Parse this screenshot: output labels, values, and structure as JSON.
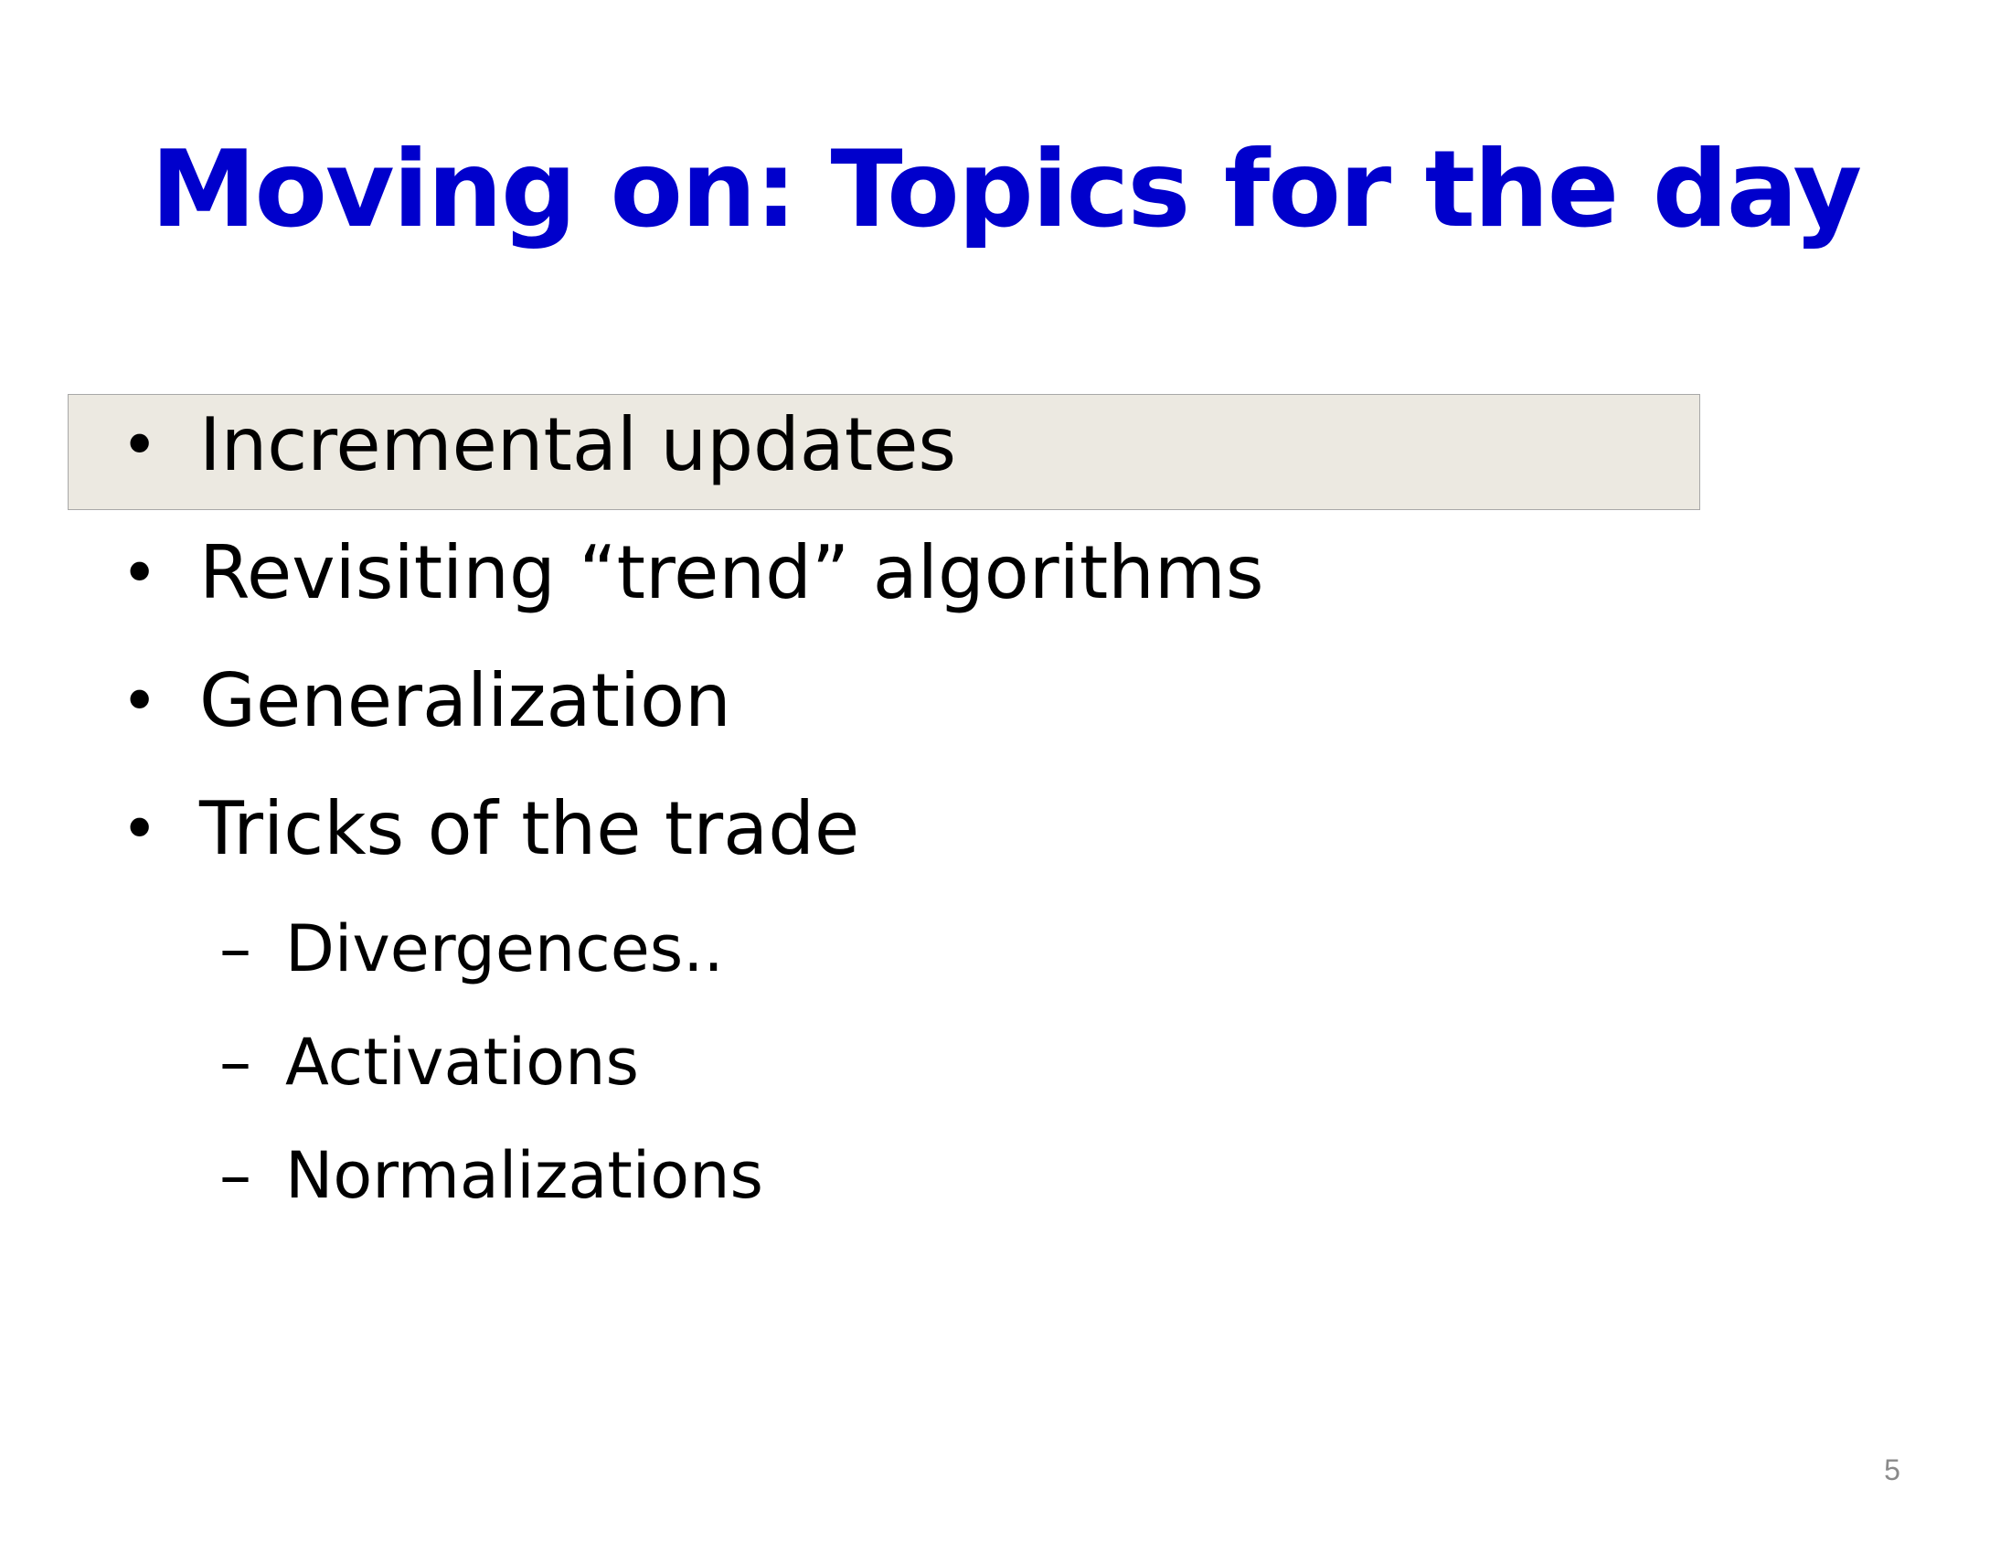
{
  "slide": {
    "title": "Moving on: Topics for the day",
    "bullets": [
      "Incremental updates",
      "Revisiting “trend” algorithms",
      "Generalization",
      "Tricks of the trade"
    ],
    "sub_bullets": [
      "Divergences..",
      "Activations",
      "Normalizations"
    ],
    "bullet_marker": "•",
    "sub_bullet_marker": "–",
    "page_number": "5",
    "highlighted_item_index": 0,
    "colors": {
      "title": "#0000cc",
      "highlight_fill": "#ece9e1",
      "text": "#000000",
      "page_number": "#8a8a8a"
    }
  }
}
